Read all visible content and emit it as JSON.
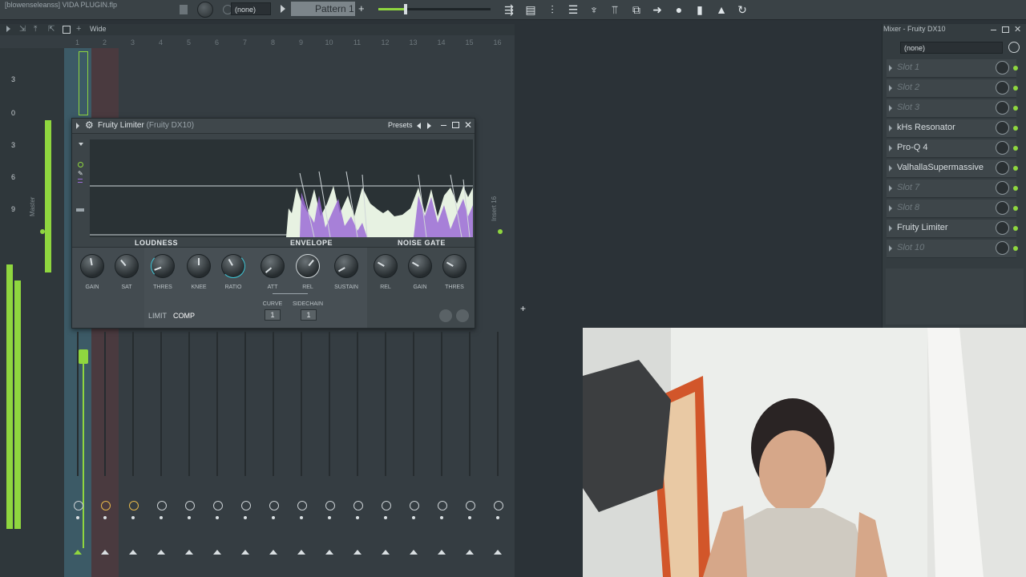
{
  "project_title": "[blowenseleanss] VIDA  PLUGIN.flp",
  "toolbar": {
    "pattern_selector": "(none)",
    "pattern_label": "Pattern 1",
    "tools": [
      "playlist-icon",
      "piano-roll-icon",
      "mixer-icon",
      "channel-rack-icon",
      "plugin-picker-icon",
      "browser-icon",
      "tempo-icon",
      "arrow-icon",
      "mic-icon",
      "file-icon",
      "stamp-icon",
      "undo-icon"
    ]
  },
  "mixer_header": {
    "view_label": "Wide"
  },
  "tracks": {
    "numbers": [
      "1",
      "2",
      "3",
      "4",
      "5",
      "6",
      "7",
      "8",
      "9",
      "10",
      "11",
      "12",
      "13",
      "14",
      "15",
      "16"
    ],
    "master_label": "Master",
    "insert_label": "Insert 16",
    "scale": [
      "3",
      "0",
      "3",
      "6",
      "9"
    ]
  },
  "plugin": {
    "name": "Fruity Limiter",
    "subtitle": "(Fruity DX10)",
    "presets_label": "Presets",
    "sections": {
      "loudness": "LOUDNESS",
      "envelope": "ENVELOPE",
      "noise_gate": "NOISE GATE"
    },
    "knobs": {
      "gain": "GAIN",
      "sat": "SAT",
      "thres": "THRES",
      "knee": "KNEE",
      "ratio": "RATIO",
      "att": "ATT",
      "rel": "REL",
      "sustain": "SUSTAIN",
      "gate_rel": "REL",
      "gate_gain": "GAIN",
      "gate_thres": "THRES"
    },
    "curve_label": "CURVE",
    "curve_value": "1",
    "sidechain_label": "SIDECHAIN",
    "sidechain_value": "1",
    "mode_limit": "LIMIT",
    "mode_comp": "COMP",
    "active_mode": "COMP"
  },
  "mixer_panel": {
    "title": "Mixer - Fruity DX10",
    "input_selector": "(none)",
    "slots": [
      {
        "label": "Slot 1",
        "filled": false
      },
      {
        "label": "Slot 2",
        "filled": false
      },
      {
        "label": "Slot 3",
        "filled": false
      },
      {
        "label": "kHs Resonator",
        "filled": true
      },
      {
        "label": "Pro-Q 4",
        "filled": true
      },
      {
        "label": "ValhallaSupermassive",
        "filled": true
      },
      {
        "label": "Slot 7",
        "filled": false
      },
      {
        "label": "Slot 8",
        "filled": false
      },
      {
        "label": "Fruity Limiter",
        "filled": true
      },
      {
        "label": "Slot 10",
        "filled": false
      }
    ]
  },
  "colors": {
    "accent_green": "#8fd63f",
    "envelope_purple": "#9b6cd6",
    "ratio_arc": "#3fc6d6"
  }
}
